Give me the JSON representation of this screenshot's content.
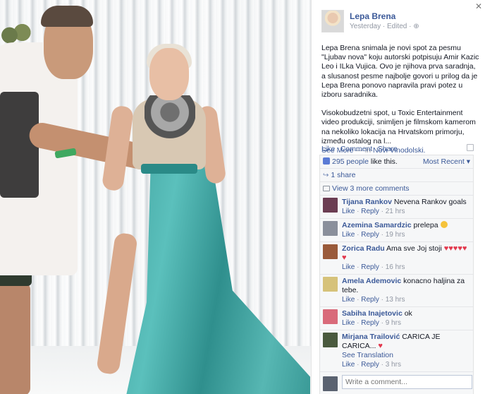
{
  "post": {
    "page_name": "Lepa Brena",
    "time": "Yesterday",
    "edited": "Edited",
    "paragraph1": "Lepa Brena snimala je novi spot za pesmu \"Ljubav nova\" koju autorski potpisuju Amir Kazic Leo i ILka Vujica. Ovo je njihova prva saradnja, a slusanost pesme najbolje govori u prilog da je Lepa Brena ponovo napravila pravi potez u izboru saradnika.",
    "paragraph2": "Visokobudzetni spot, u Toxic Entertainment video produkciji, snimljen je filmskom kamerom na nekoliko lokacija na Hrvatskom primorju, između ostalog na l...",
    "see_more": "See More",
    "location_prefix": "— in",
    "location": "Novi Vinodolski."
  },
  "actions": {
    "like": "Like",
    "comment": "Comment",
    "share": "Share"
  },
  "ufi": {
    "likes_text": "295 people",
    "likes_suffix": "like this.",
    "sort_label": "Most Recent",
    "shares": "1 share",
    "view_more": "View 3 more comments"
  },
  "comments": [
    {
      "name": "Tijana Rankov",
      "text": "Nevena Rankov goals",
      "time": "21 hrs",
      "avatar_color": "#6b3d52"
    },
    {
      "name": "Azemina Samardzic",
      "text": "prelepa",
      "time": "19 hrs",
      "avatar_color": "#8a8f9b"
    },
    {
      "name": "Zorica Radu",
      "text": "Ama sve Joj stoji",
      "time": "16 hrs",
      "avatar_color": "#9a5a3a"
    },
    {
      "name": "Amela Ademovic",
      "text": "konacno haljina za tebe.",
      "time": "13 hrs",
      "avatar_color": "#d6c27a"
    },
    {
      "name": "Sabiha Inajetovic",
      "text": "ok",
      "time": "9 hrs",
      "avatar_color": "#d96a7a"
    },
    {
      "name": "Mirjana Trailović",
      "text": "CARICA JE CARICA...",
      "translation": "See Translation",
      "time": "3 hrs",
      "avatar_color": "#4a5a3e"
    }
  ],
  "comment_like": "Like",
  "comment_reply": "Reply",
  "write_placeholder": "Write a comment..."
}
